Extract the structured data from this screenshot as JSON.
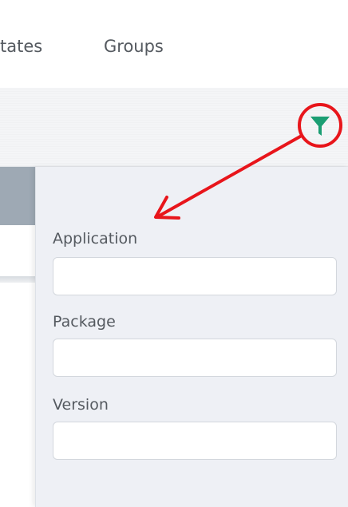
{
  "tabs": [
    {
      "label": "tates"
    },
    {
      "label": "Groups"
    }
  ],
  "filter_panel": {
    "fields": [
      {
        "label": "Application",
        "value": "",
        "placeholder": ""
      },
      {
        "label": "Package",
        "value": "",
        "placeholder": ""
      },
      {
        "label": "Version",
        "value": "",
        "placeholder": ""
      }
    ]
  },
  "icons": {
    "filter": "filter-funnel-icon"
  },
  "colors": {
    "filter_icon": "#1a9e73",
    "annotation": "#e8151b",
    "table_header": "#9ea9b4",
    "panel_bg": "#eef0f5"
  }
}
